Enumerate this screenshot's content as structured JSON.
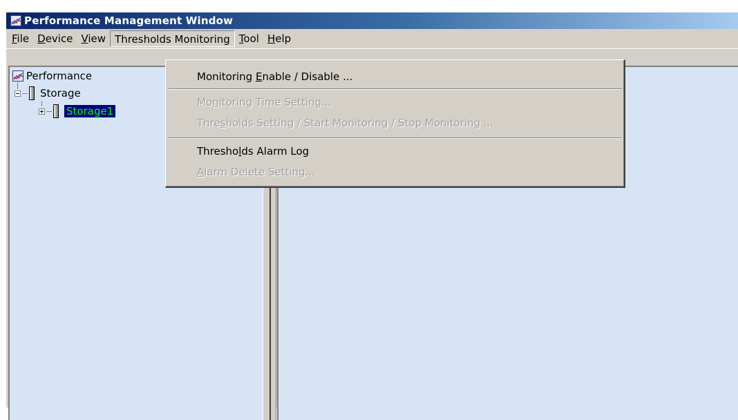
{
  "window": {
    "title": "Performance Management Window",
    "icon": "chart-window-icon"
  },
  "menubar": {
    "items": [
      {
        "label": "File",
        "mnemonic": "F",
        "rest": "ile"
      },
      {
        "label": "Device",
        "mnemonic": "D",
        "rest": "evice"
      },
      {
        "label": "View",
        "mnemonic": "V",
        "rest": "iew"
      },
      {
        "label": "Thresholds Monitoring",
        "active": true
      },
      {
        "label": "Tool",
        "mnemonic": "T",
        "rest": "ool"
      },
      {
        "label": "Help",
        "mnemonic": "H",
        "rest": "elp"
      }
    ]
  },
  "tree": {
    "root": {
      "label": "Performance",
      "icon": "performance-chart-icon"
    },
    "storage": {
      "label": "Storage",
      "icon": "storage-device-icon",
      "expanded": true
    },
    "storage1": {
      "label": "Storage1",
      "icon": "storage-device-icon",
      "expanded": false,
      "selected": true
    }
  },
  "dropdown": {
    "items": [
      {
        "pre": "Monitoring ",
        "mnemonic": "E",
        "post": "nable / Disable ...",
        "enabled": true
      },
      {
        "pre": "Mo",
        "mnemonic": "n",
        "post": "itoring Time Setting...",
        "enabled": false
      },
      {
        "pre": "Thre",
        "mnemonic": "s",
        "post": "holds Setting / Start Monitoring / Stop Monitoring ...",
        "enabled": false
      },
      {
        "pre": "Thresho",
        "mnemonic": "l",
        "post": "ds Alarm Log",
        "enabled": true
      },
      {
        "pre": "",
        "mnemonic": "A",
        "post": "larm Delete Setting...",
        "enabled": false
      }
    ]
  },
  "colors": {
    "title_start": "#0a246a",
    "title_end": "#a6caf0",
    "pane_bg": "#d6e4f6",
    "selection_bg": "#000080",
    "selection_fg": "#00ff00"
  }
}
